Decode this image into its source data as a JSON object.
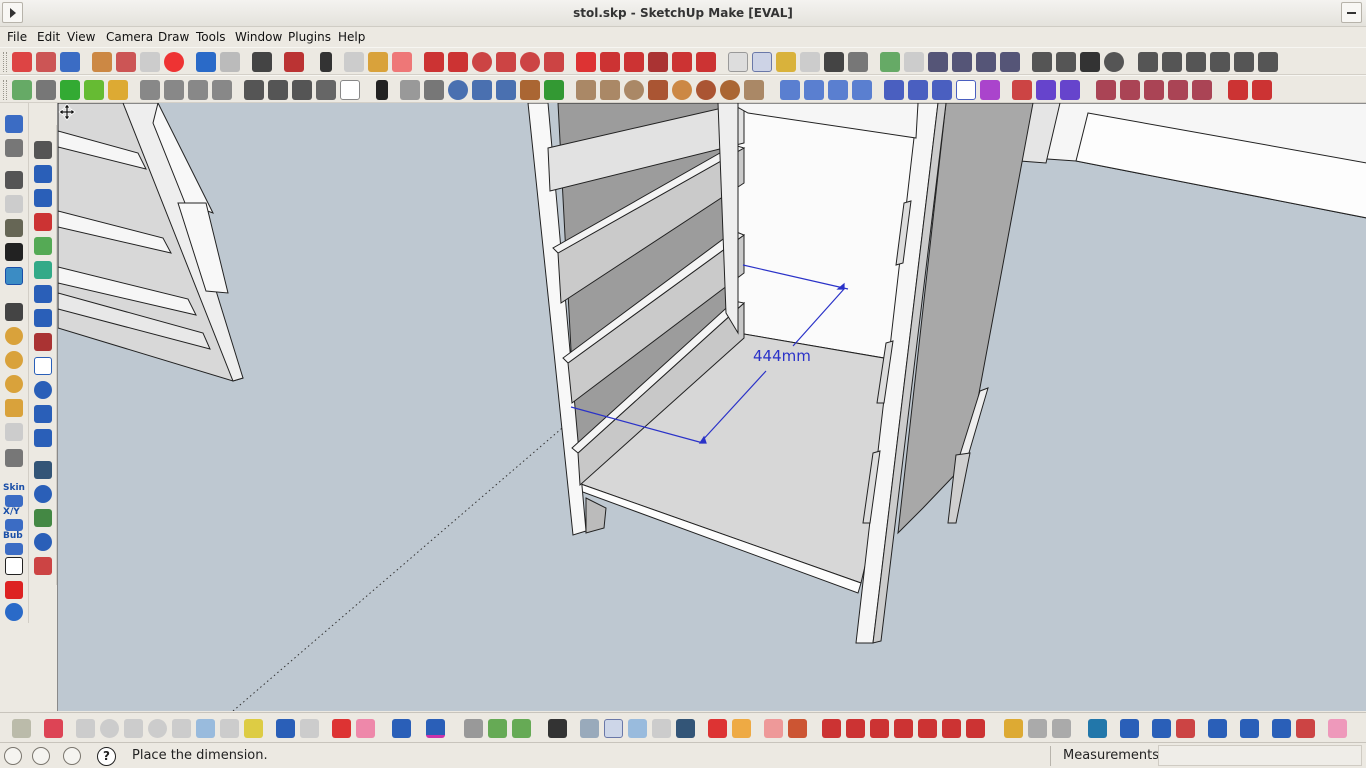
{
  "window": {
    "title": "stol.skp - SketchUp Make [EVAL]"
  },
  "menubar": {
    "items": [
      "File",
      "Edit",
      "View",
      "Camera",
      "Draw",
      "Tools",
      "Window",
      "Plugins",
      "Help"
    ]
  },
  "left_toolbar": {
    "labels": [
      "Skin",
      "X/Y",
      "Bub"
    ]
  },
  "viewport": {
    "background_color": "#bec8d1",
    "dimension_label": "444mm",
    "dimension_color": "#2a32c8",
    "cursor": "move-cursor-icon"
  },
  "statusbar": {
    "hint": "Place the dimension.",
    "help_glyph": "?",
    "measurements_label": "Measurements",
    "measurements_value": ""
  },
  "colors": {
    "chrome": "#ece9e2",
    "accent_blue": "#2a32c8"
  }
}
